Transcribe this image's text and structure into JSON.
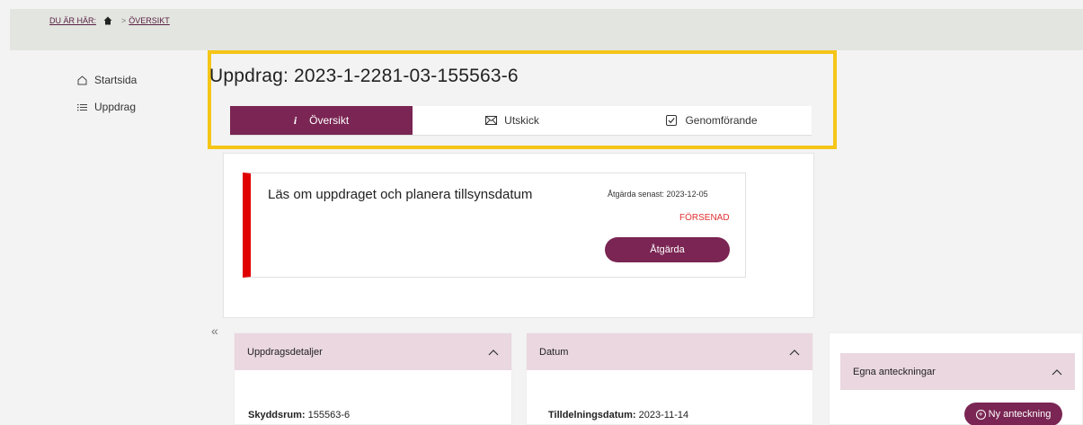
{
  "breadcrumb": {
    "prefix": "DU ÄR HÄR:",
    "separator": ">",
    "current": "ÖVERSIKT"
  },
  "sidebar": {
    "items": [
      {
        "label": "Startsida",
        "icon": "home-outline-icon"
      },
      {
        "label": "Uppdrag",
        "icon": "list-icon"
      }
    ]
  },
  "page": {
    "title": "Uppdrag: 2023-1-2281-03-155563-6"
  },
  "tabs": [
    {
      "label": "Översikt",
      "icon": "info-icon",
      "active": true
    },
    {
      "label": "Utskick",
      "icon": "envelope-icon",
      "active": false
    },
    {
      "label": "Genomförande",
      "icon": "checkbox-icon",
      "active": false
    }
  ],
  "task": {
    "title": "Läs om uppdraget och planera tillsynsdatum",
    "due": "Åtgärda senast: 2023-12-05",
    "status": "FÖRSENAD",
    "action_label": "Åtgärda"
  },
  "collapse_glyph": "«",
  "cards": {
    "details": {
      "title": "Uppdragsdetaljer",
      "row_label": "Skyddsrum:",
      "row_value": "155563-6"
    },
    "dates": {
      "title": "Datum",
      "row_label": "Tilldelningsdatum:",
      "row_value": "2023-11-14"
    },
    "notes": {
      "title": "Egna anteckningar",
      "new_label": "Ny anteckning"
    }
  },
  "colors": {
    "brand": "#7a2553",
    "highlight": "#f5c518",
    "alert": "#e00000",
    "card_header": "#ead7e0"
  }
}
